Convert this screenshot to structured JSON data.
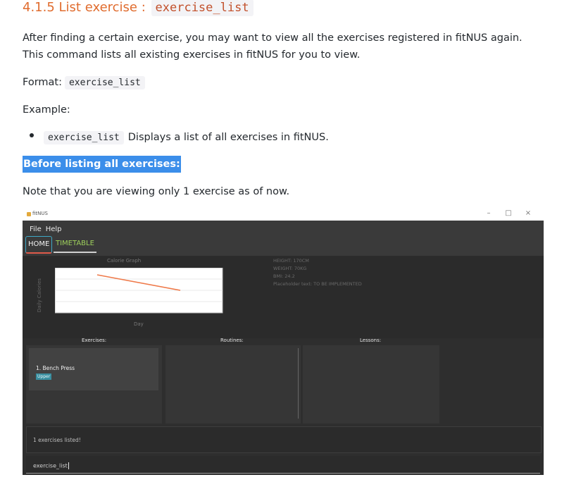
{
  "heading": {
    "prefix": "4.1.5 List exercise : ",
    "code": "exercise_list"
  },
  "intro": "After finding a certain exercise, you may want to view all the exercises registered in fitNUS again. This command lists all existing exercises in fitNUS for you to view.",
  "format": {
    "label": "Format:",
    "code": "exercise_list"
  },
  "example_label": "Example:",
  "example": {
    "code": "exercise_list",
    "text": "Displays a list of all exercises in fitNUS."
  },
  "highlight": "Before listing all exercises:",
  "note": "Note that you are viewing only 1 exercise as of now.",
  "app": {
    "window_title": "fitNUS",
    "window_controls": [
      "–",
      "□",
      "×"
    ],
    "menu": [
      "File",
      "Help"
    ],
    "tabs": [
      "HOME",
      "TIMETABLE"
    ],
    "chart_title": "Calorie Graph",
    "chart_ylabel": "Daily Calories",
    "chart_xlabel": "Day",
    "stats": [
      "HEIGHT: 170CM",
      "WEIGHT: 70KG",
      "BMI: 24.2",
      "Placeholder text: TO BE IMPLEMENTED"
    ],
    "columns": [
      "Exercises:",
      "Routines:",
      "Lessons:"
    ],
    "exercise_item": {
      "name": "1. Bench Press",
      "tag": "Upper"
    },
    "result": "1 exercises listed!",
    "command": "exercise_list"
  }
}
